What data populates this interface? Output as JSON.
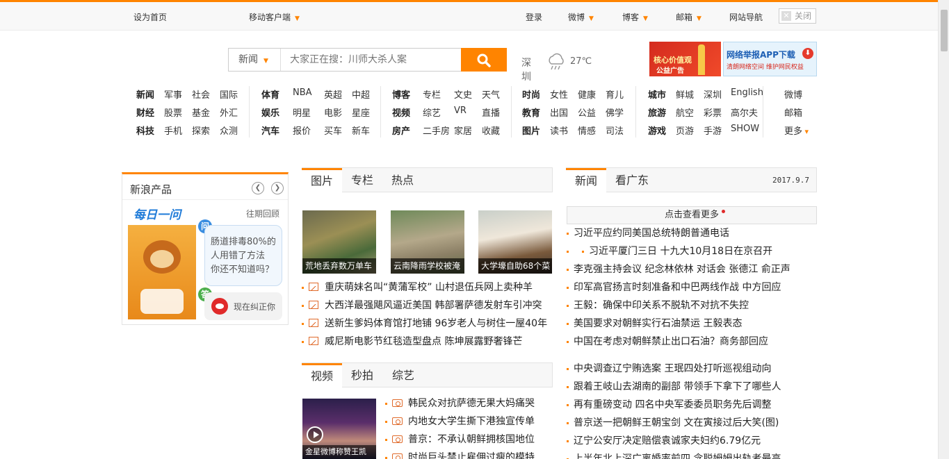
{
  "topbar": {
    "set_home": "设为首页",
    "mobile_client": "移动客户端",
    "login": "登录",
    "weibo": "微博",
    "blog": "博客",
    "mail": "邮箱",
    "site_nav": "网站导航",
    "close": "关闭"
  },
  "search": {
    "category": "新闻",
    "placeholder": "大家正在搜：川师大杀人案"
  },
  "weather": {
    "city": "深圳",
    "temp": "27℃",
    "icon": "cloud-rain-icon"
  },
  "ads": {
    "ad1_line1": "核心价值观",
    "ad1_line2": "公益广告",
    "ad2_line1": "网络举报APP下载",
    "ad2_line2": "清朗网络空间 维护网民权益"
  },
  "nav": {
    "g1": [
      [
        "新闻",
        "军事",
        "社会",
        "国际"
      ],
      [
        "财经",
        "股票",
        "基金",
        "外汇"
      ],
      [
        "科技",
        "手机",
        "探索",
        "众测"
      ]
    ],
    "g2": [
      [
        "体育",
        "NBA",
        "英超",
        "中超"
      ],
      [
        "娱乐",
        "明星",
        "电影",
        "星座"
      ],
      [
        "汽车",
        "报价",
        "买车",
        "新车"
      ]
    ],
    "g3": [
      [
        "博客",
        "专栏",
        "文史",
        "天气"
      ],
      [
        "视频",
        "综艺",
        "VR",
        "直播"
      ],
      [
        "房产",
        "二手房",
        "家居",
        "收藏"
      ]
    ],
    "g4": [
      [
        "时尚",
        "女性",
        "健康",
        "育儿"
      ],
      [
        "教育",
        "出国",
        "公益",
        "佛学"
      ],
      [
        "图片",
        "读书",
        "情感",
        "司法"
      ]
    ],
    "g5": [
      [
        "城市",
        "鲜城",
        "深圳",
        "English"
      ],
      [
        "旅游",
        "航空",
        "彩票",
        "高尔夫"
      ],
      [
        "游戏",
        "页游",
        "手游",
        "SHOW"
      ]
    ],
    "g6": [
      "微博",
      "邮箱",
      "更多"
    ]
  },
  "products": {
    "title": "新浪产品",
    "daily_ask": "每日一问",
    "past": "往期回顾",
    "q_badge": "问",
    "a_badge": "答",
    "bubble": [
      "肠道排毒80%的",
      "人用错了方法",
      "你还不知道吗？"
    ],
    "correct": "现在纠正你"
  },
  "pictures": {
    "tabs": [
      "图片",
      "专栏",
      "热点"
    ],
    "thumbs": [
      "荒地丢弃数万单车",
      "云南降雨学校被淹",
      "大学壕自助68个菜"
    ],
    "news": [
      "重庆萌妹名叫“黄蒲军校” 山村退伍兵网上卖种羊",
      "大西洋最强飓风逼近美国 韩部署萨德发射车引冲突",
      "送新生爹妈体育馆打地铺 96岁老人与树住一屋40年",
      "威尼斯电影节红毯造型盘点 陈坤展露野奢锋芒"
    ]
  },
  "videos": {
    "tabs": [
      "视频",
      "秒拍",
      "综艺"
    ],
    "thumb_caption": "金星微博称赞王凯",
    "news": [
      "韩民众对抗萨德无果大妈痛哭",
      "内地女大学生撕下港独宣传单",
      "普京：不承认朝鲜拥核国地位",
      "时尚巨头禁止雇佣过瘦的模特"
    ]
  },
  "news": {
    "tabs": [
      "新闻",
      "看广东"
    ],
    "date": "2017.9.7",
    "check_more": "点击查看更多",
    "items": [
      "习近平应约同美国总统特朗普通电话",
      "习近平厦门三日 十九大10月18日在京召开",
      "李克强主持会议 纪念林依林 对话会 张德江 俞正声",
      "印军高官扬言时刻准备和中巴两线作战 中方回应",
      "王毅：确保中印关系不脱轨不对抗不失控",
      "美国要求对朝鲜实行石油禁运 王毅表态",
      "中国在考虑对朝鲜禁止出口石油？商务部回应",
      "中央调查辽宁贿选案 王珉四处打听巡视组动向",
      "跟着王岐山去湖南的副部 带领手下拿下了哪些人",
      "再有重磅变动 四名中央军委委员职务先后调整",
      "普京送一把朝鲜王朝宝剑 文在寅接过后大笑(图)",
      "辽宁公安厅决定赔偿袁诚家夫妇约6.79亿元",
      "上半年北上深广离婚率前四 念聪姆姆出轨者最高"
    ]
  },
  "colors": {
    "accent": "#ff8400"
  }
}
